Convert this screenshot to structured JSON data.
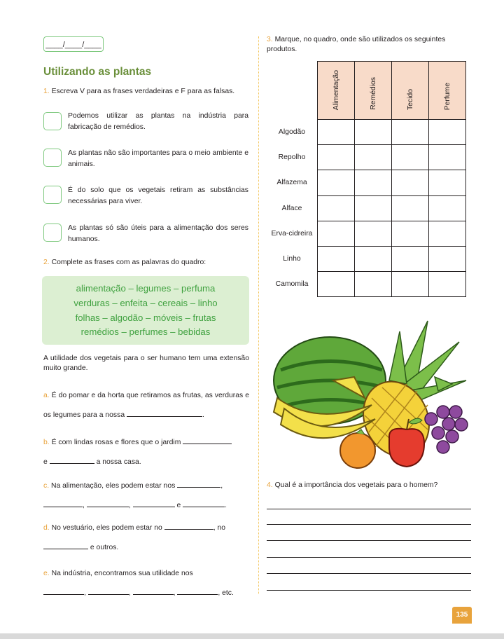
{
  "header": {
    "date_placeholder": "____/____/____"
  },
  "section": {
    "title": "Utilizando as plantas"
  },
  "q1": {
    "number": "1.",
    "prompt": "Escreva V para as frases verdadeiras e F para as falsas.",
    "statements": [
      "Podemos utilizar as plantas na indústria para fabricação de remédios.",
      "As plantas não são importantes para o meio ambiente e animais.",
      "É do solo que os vegetais retiram as substâncias necessárias para viver.",
      "As plantas só são úteis para a alimentação dos seres humanos."
    ]
  },
  "q2": {
    "number": "2.",
    "prompt": "Complete as frases com as palavras do quadro:",
    "word_box": [
      "alimentação – legumes – perfuma",
      "verduras – enfeita – cereais – linho",
      "folhas – algodão – móveis – frutas",
      "remédios – perfumes – bebidas"
    ],
    "intro": "A utilidade dos vegetais para o ser humano tem uma extensão muito grande.",
    "a": {
      "letter": "a.",
      "text1": "É do pomar e da horta que retiramos as frutas, as verduras e os legumes para a nossa",
      "end": "."
    },
    "b": {
      "letter": "b.",
      "text1": "É com lindas rosas e flores que o jardim",
      "e": "e",
      "text2": "a nossa casa."
    },
    "c": {
      "letter": "c.",
      "text1": "Na alimentação, eles podem estar nos",
      "sep": ",",
      "e": "e",
      "end": "."
    },
    "d": {
      "letter": "d.",
      "text1": "No vestuário, eles podem estar no",
      "no": ", no",
      "text2": "e outros."
    },
    "e": {
      "letter": "e.",
      "text1": "Na indústria, encontramos sua utilidade nos",
      "end": ", etc."
    }
  },
  "q3": {
    "number": "3.",
    "prompt": "Marque, no quadro, onde são utilizados os seguintes produtos.",
    "columns": [
      "Alimentação",
      "Remédios",
      "Tecido",
      "Perfume"
    ],
    "rows": [
      "Algodão",
      "Repolho",
      "Alfazema",
      "Alface",
      "Erva-cidreira",
      "Linho",
      "Camomila"
    ]
  },
  "q4": {
    "number": "4.",
    "prompt": "Qual é a importância dos vegetais para o homem?"
  },
  "page_number": "135"
}
